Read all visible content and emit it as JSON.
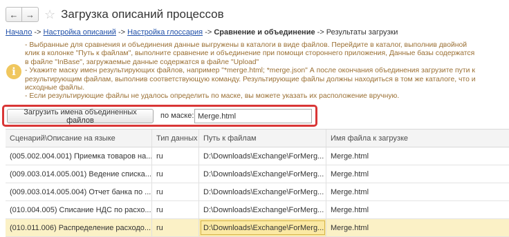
{
  "window": {
    "title": "Загрузка описаний процессов",
    "back_glyph": "←",
    "forward_glyph": "→",
    "star_glyph": "☆"
  },
  "breadcrumb": {
    "home": "Начало",
    "sep1": " -> ",
    "settings": "Настройка описаний",
    "sep2": " -> ",
    "glossary": "Настройка глоссария",
    "sep3": " -> ",
    "current": "Сравнение и объединение",
    "sep4": " -> ",
    "tail": "Результаты загрузки"
  },
  "info": {
    "icon_glyph": "i",
    "lines": [
      " - Выбранные для сравнения и объединения данные выгружены в каталоги в виде файлов. Перейдите в каталог, выполнив двойной клик в колонке \"Путь к файлам\", выполните сравнение и объединение  при помощи стороннего приложения, Данные базы содержатся в файле \"InBase\", загружаемые данные содержатся в файле \"Upload\"",
      " - Укажите маску имен результирующих файлов, например \"*merge.html; *merge.json\" А после окончания объединения загрузите пути к результирующим файлам, выполнив соответствующую команду. Результирующие файлы должны находиться в том же каталоге, что и исходные файлы.",
      " - Если результирующие файлы не удалось определить по маске, вы можете указать их расположение вручную."
    ]
  },
  "controls": {
    "load_button": "Загрузить имена объединенных файлов",
    "mask_label": "по маске:",
    "mask_value": "Merge.html"
  },
  "table": {
    "columns": [
      "Сценарий\\Описание на языке",
      "Тип данных",
      "Путь к файлам",
      "Имя файла к загрузке"
    ],
    "rows": [
      [
        "(005.002.004.001) Приемка товаров на...",
        "ru",
        "D:\\Downloads\\Exchange\\ForMerg...",
        "Merge.html"
      ],
      [
        "(009.003.014.005.001) Ведение списка...",
        "ru",
        "D:\\Downloads\\Exchange\\ForMerg...",
        "Merge.html"
      ],
      [
        "(009.003.014.005.004) Отчет банка по ...",
        "ru",
        "D:\\Downloads\\Exchange\\ForMerg...",
        "Merge.html"
      ],
      [
        "(010.004.005) Списание НДС по расхо...",
        "ru",
        "D:\\Downloads\\Exchange\\ForMerg...",
        "Merge.html"
      ],
      [
        "(010.011.006) Распределение расходо...",
        "ru",
        "D:\\Downloads\\Exchange\\ForMerg...",
        "Merge.html"
      ]
    ],
    "selected_row": 4
  },
  "colors": {
    "info_text": "#9a6f33",
    "highlight_border": "#d93636",
    "selected_row": "#fbf1c6",
    "link": "#1f4fa8"
  }
}
